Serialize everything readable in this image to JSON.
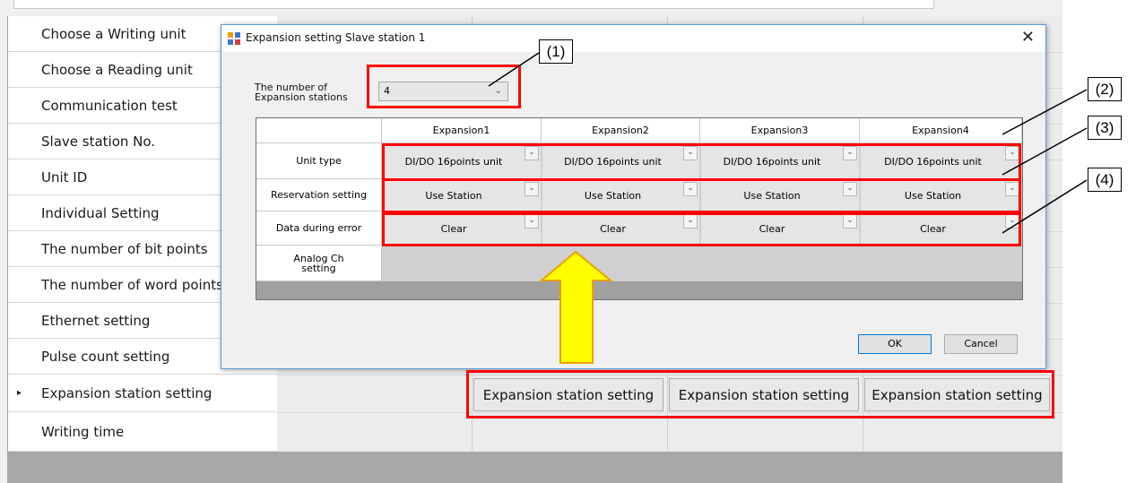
{
  "settings_rows": [
    {
      "label": "Choose a Writing unit"
    },
    {
      "label": "Choose a Reading unit"
    },
    {
      "label": "Communication test"
    },
    {
      "label": "Slave station No."
    },
    {
      "label": "Unit ID"
    },
    {
      "label": "Individual Setting"
    },
    {
      "label": "The number of bit points"
    },
    {
      "label": "The number of word points"
    },
    {
      "label": "Ethernet setting"
    },
    {
      "label": "Pulse count setting"
    },
    {
      "label": "Expansion station setting"
    },
    {
      "label": "Writing time"
    }
  ],
  "selected_row_marker": "▸",
  "expansion_buttons": [
    "Expansion station setting",
    "Expansion station setting",
    "Expansion station setting"
  ],
  "dialog": {
    "title": "Expansion setting Slave station 1",
    "close_symbol": "✕",
    "num_stations_label": "The number of Expansion stations",
    "num_stations_value": "4",
    "columns": [
      "Expansion1",
      "Expansion2",
      "Expansion3",
      "Expansion4"
    ],
    "row_labels": [
      "Unit type",
      "Reservation setting",
      "Data during error",
      "Analog Ch setting"
    ],
    "unit_type": [
      "DI/DO 16points unit",
      "DI/DO 16points unit",
      "DI/DO 16points unit",
      "DI/DO 16points unit"
    ],
    "reservation": [
      "Use Station",
      "Use Station",
      "Use Station",
      "Use Station"
    ],
    "data_error": [
      "Clear",
      "Clear",
      "Clear",
      "Clear"
    ],
    "ok_label": "OK",
    "cancel_label": "Cancel"
  },
  "callouts": [
    "(1)",
    "(2)",
    "(3)",
    "(4)"
  ],
  "colors": {
    "highlight": "#ff0000",
    "arrow_fill": "#ffff00",
    "arrow_stroke": "#f0a000",
    "dialog_border": "#5b9bd5"
  },
  "icons": [
    "app-icon",
    "close-icon",
    "dropdown-icon",
    "up-arrow-icon",
    "row-selector-icon"
  ]
}
